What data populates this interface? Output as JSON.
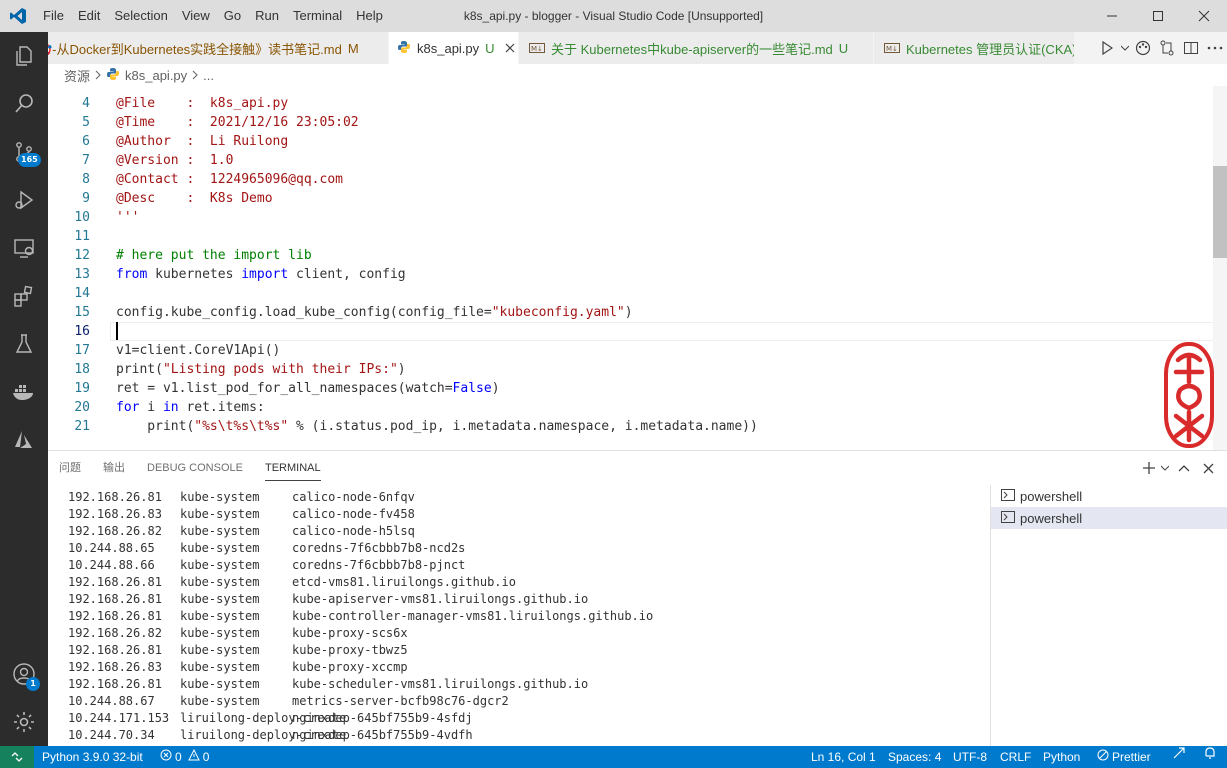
{
  "menu": [
    "File",
    "Edit",
    "Selection",
    "View",
    "Go",
    "Run",
    "Terminal",
    "Help"
  ],
  "window_title": "k8s_api.py - blogger - Visual Studio Code [Unsupported]",
  "tabs": [
    {
      "label": "🎯-从Docker到Kubernetes实践全接触》读书笔记.md",
      "status": "M",
      "active": false
    },
    {
      "label": "k8s_api.py",
      "status": "U",
      "active": true
    },
    {
      "label": "关于 Kubernetes中kube-apiserver的一些笔记.md",
      "status": "U",
      "active": false
    },
    {
      "label": "Kubernetes 管理员认证(CKA)考试笔记",
      "status": "",
      "active": false
    }
  ],
  "breadcrumb": {
    "root": "资源",
    "file": "k8s_api.py",
    "more": "..."
  },
  "badges": {
    "source_control": "165",
    "accounts": "1"
  },
  "editor": {
    "current_line": 16,
    "lines": [
      {
        "n": "4",
        "text": "@File    :  k8s_api.py"
      },
      {
        "n": "5",
        "text": "@Time    :  2021/12/16 23:05:02"
      },
      {
        "n": "6",
        "text": "@Author  :  Li Ruilong"
      },
      {
        "n": "7",
        "text": "@Version :  1.0"
      },
      {
        "n": "8",
        "text": "@Contact :  1224965096@qq.com"
      },
      {
        "n": "9",
        "text": "@Desc    :  K8s Demo"
      },
      {
        "n": "10",
        "text": "'''"
      },
      {
        "n": "11",
        "text": ""
      },
      {
        "n": "12",
        "text": "# here put the import lib"
      },
      {
        "n": "13",
        "text": "from kubernetes import client, config"
      },
      {
        "n": "14",
        "text": ""
      },
      {
        "n": "15",
        "text": "config.kube_config.load_kube_config(config_file=\"kubeconfig.yaml\")"
      },
      {
        "n": "16",
        "text": ""
      },
      {
        "n": "17",
        "text": "v1=client.CoreV1Api()"
      },
      {
        "n": "18",
        "text": "print(\"Listing pods with their IPs:\")"
      },
      {
        "n": "19",
        "text": "ret = v1.list_pod_for_all_namespaces(watch=False)"
      },
      {
        "n": "20",
        "text": "for i in ret.items:"
      },
      {
        "n": "21",
        "text": "    print(\"%s\\t%s\\t%s\" % (i.status.pod_ip, i.metadata.namespace, i.metadata.name))"
      }
    ]
  },
  "panel": {
    "tabs": [
      "问题",
      "输出",
      "DEBUG CONSOLE",
      "TERMINAL"
    ],
    "active_tab": "TERMINAL",
    "terminals": [
      "powershell",
      "powershell"
    ]
  },
  "terminal_rows": [
    [
      "192.168.26.81",
      "kube-system",
      "calico-node-6nfqv"
    ],
    [
      "192.168.26.83",
      "kube-system",
      "calico-node-fv458"
    ],
    [
      "192.168.26.82",
      "kube-system",
      "calico-node-h5lsq"
    ],
    [
      "10.244.88.65",
      "kube-system",
      "coredns-7f6cbbb7b8-ncd2s"
    ],
    [
      "10.244.88.66",
      "kube-system",
      "coredns-7f6cbbb7b8-pjnct"
    ],
    [
      "192.168.26.81",
      "kube-system",
      "etcd-vms81.liruilongs.github.io"
    ],
    [
      "192.168.26.81",
      "kube-system",
      "kube-apiserver-vms81.liruilongs.github.io"
    ],
    [
      "192.168.26.81",
      "kube-system",
      "kube-controller-manager-vms81.liruilongs.github.io"
    ],
    [
      "192.168.26.82",
      "kube-system",
      "kube-proxy-scs6x"
    ],
    [
      "192.168.26.81",
      "kube-system",
      "kube-proxy-tbwz5"
    ],
    [
      "192.168.26.83",
      "kube-system",
      "kube-proxy-xccmp"
    ],
    [
      "192.168.26.81",
      "kube-system",
      "kube-scheduler-vms81.liruilongs.github.io"
    ],
    [
      "10.244.88.67",
      "kube-system",
      "metrics-server-bcfb98c76-dgcr2"
    ],
    [
      "10.244.171.153",
      "liruilong-deploy-create",
      "nginxdep-645bf755b9-4sfdj"
    ],
    [
      "10.244.70.34",
      "liruilong-deploy-create",
      "nginxdep-645bf755b9-4vdfh"
    ]
  ],
  "status": {
    "python": "Python 3.9.0 32-bit",
    "errors": "0",
    "warnings": "0",
    "position": "Ln 16, Col 1",
    "spaces": "Spaces: 4",
    "encoding": "UTF-8",
    "eol": "CRLF",
    "language": "Python",
    "prettier": "Prettier"
  },
  "colors": {
    "accent": "#007acc",
    "statusbar": "#007acc",
    "remote": "#16825d",
    "activitybar": "#2c2c2c"
  }
}
